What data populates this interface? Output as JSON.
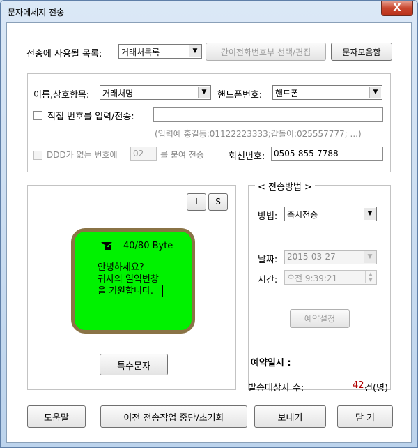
{
  "window": {
    "title": "문자메세지 전송",
    "close_label": "X"
  },
  "top": {
    "list_label": "전송에 사용될 목록:",
    "list_value": "거래처목록",
    "phonebook_button": "간이전화번호부 선택/편집",
    "collection_button": "문자모음함"
  },
  "recipients": {
    "name_label": "이름,상호항목:",
    "name_value": "거래처명",
    "phone_label": "핸드폰번호:",
    "phone_value": "핸드폰",
    "direct_label": "직접 번호를 입력/전송:",
    "direct_value": "",
    "example_text": "(입력예 홍길동:01122223333;갑돌이:025557777; ...)",
    "ddd_label": "DDD가 없는 번호에",
    "ddd_value": "02",
    "ddd_suffix": "를 붙여 전송",
    "callback_label": "회신번호:",
    "callback_value": "0505-855-7788"
  },
  "message": {
    "btn_i": "I",
    "btn_s": "S",
    "byte_counter": "40/80 Byte",
    "lines": [
      "안녕하세요?",
      "귀사의 일익번창",
      "을 기원합니다."
    ],
    "special_chars_button": "특수문자"
  },
  "send_method": {
    "group_title": "< 전송방법 >",
    "method_label": "방법:",
    "method_value": "즉시전송",
    "date_label": "날짜:",
    "date_value": "2015-03-27",
    "time_label": "시간:",
    "time_value": "오전   9:39:21",
    "reserve_button": "예약설정",
    "reserve_datetime_label": "예약일시 :"
  },
  "summary": {
    "count_label": "발송대상자 수:",
    "count_value": "42",
    "count_unit": "건(명)"
  },
  "footer": {
    "help": "도움말",
    "reset": "이전 전송작업 중단/초기화",
    "send": "보내기",
    "close": "닫 기"
  },
  "colors": {
    "phone_screen": "#00f200",
    "phone_border": "#8a7346",
    "count_value": "#b00000"
  }
}
